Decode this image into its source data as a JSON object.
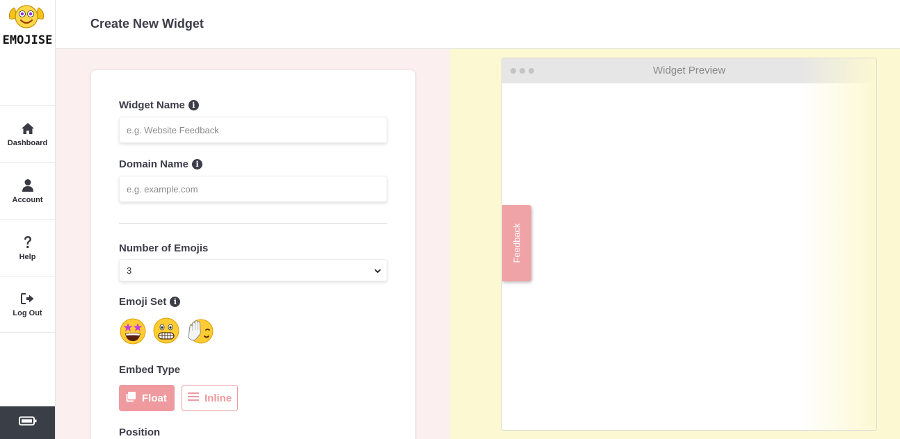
{
  "brand": {
    "name": "EMOJISE"
  },
  "header": {
    "title": "Create New Widget"
  },
  "nav": {
    "items": [
      {
        "label": "Dashboard",
        "icon": "home-icon"
      },
      {
        "label": "Account",
        "icon": "user-icon"
      },
      {
        "label": "Help",
        "icon": "question-icon"
      },
      {
        "label": "Log Out",
        "icon": "logout-icon"
      }
    ],
    "footer_icon": "battery-icon"
  },
  "form": {
    "widget_name": {
      "label": "Widget Name",
      "placeholder": "e.g. Website Feedback"
    },
    "domain_name": {
      "label": "Domain Name",
      "placeholder": "e.g. example.com"
    },
    "num_emojis": {
      "label": "Number of Emojis",
      "value": "3"
    },
    "emoji_set": {
      "label": "Emoji Set",
      "emojis": [
        "star-struck-emoji",
        "grimacing-emoji",
        "facepalm-emoji"
      ]
    },
    "embed_type": {
      "label": "Embed Type",
      "float_label": "Float",
      "inline_label": "Inline",
      "selected": "Float"
    },
    "position": {
      "label": "Position"
    }
  },
  "preview": {
    "title": "Widget Preview",
    "feedback_label": "Feedback"
  },
  "colors": {
    "accent": "#ef9a9e",
    "left_bg": "#fcefef",
    "right_bg": "#fcf8d2",
    "sidebar_footer": "#3a3f47"
  }
}
